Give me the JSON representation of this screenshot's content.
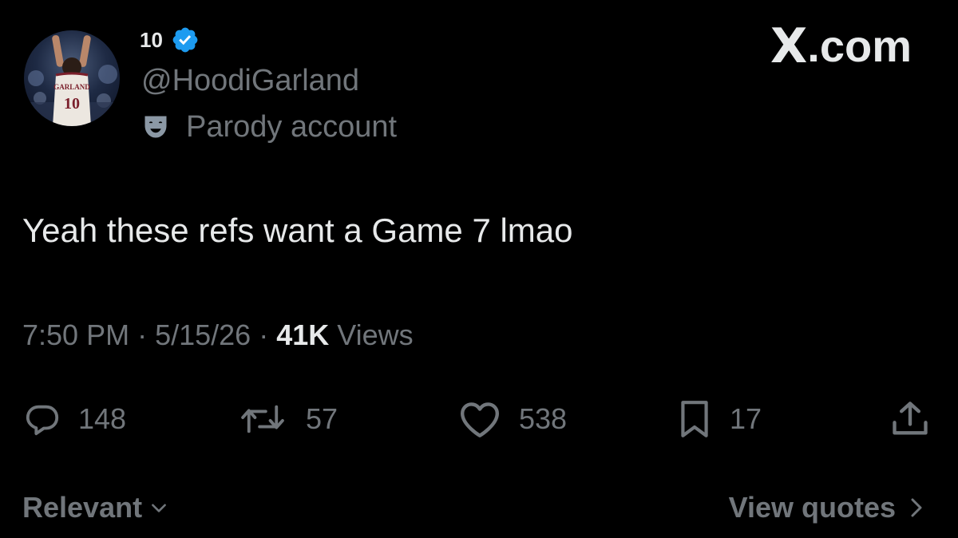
{
  "brand": {
    "logo_text": "X",
    "domain_text": ".com"
  },
  "author": {
    "display_name": "10",
    "handle": "@HoodiGarland",
    "account_label": "Parody account",
    "verified": true,
    "verified_color": "#1d9bf0",
    "avatar_jersey_text": "GARLAND",
    "avatar_jersey_number": "10"
  },
  "tweet": {
    "text": "Yeah these refs want a Game 7 lmao",
    "time": "7:50 PM",
    "separator": "·",
    "date": "5/15/26",
    "views_count": "41K",
    "views_label": "Views"
  },
  "actions": {
    "replies": "148",
    "reposts": "57",
    "likes": "538",
    "bookmarks": "17"
  },
  "footer": {
    "sort_label": "Relevant",
    "quotes_label": "View quotes"
  },
  "colors": {
    "background": "#000000",
    "primary_text": "#e7e9ea",
    "secondary_text": "#71767b",
    "accent": "#1d9bf0"
  }
}
